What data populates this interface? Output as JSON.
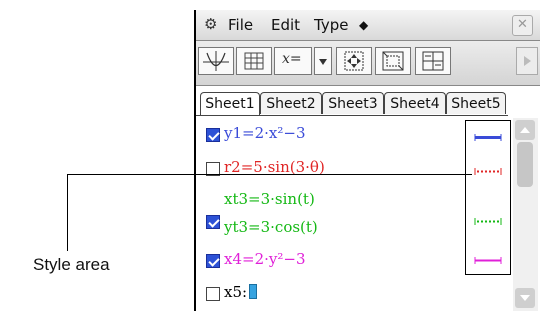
{
  "menu": {
    "items": [
      "File",
      "Edit",
      "Type"
    ]
  },
  "tabs": [
    "Sheet1",
    "Sheet2",
    "Sheet3",
    "Sheet4",
    "Sheet5"
  ],
  "rows": [
    {
      "checked": true,
      "color": "#3a4bd8",
      "line1": "y1=2·x²−3"
    },
    {
      "checked": false,
      "color": "#e02626",
      "line1": "r2=5·sin(3·θ)"
    },
    {
      "checked": true,
      "color": "#14b814",
      "line1": "xt3=3·sin(t)",
      "line2": "yt3=3·cos(t)"
    },
    {
      "checked": true,
      "color": "#e020d8",
      "line1": "x4=2·y²−3"
    },
    {
      "checked": false,
      "color": "#000000",
      "line1": "x5:"
    }
  ],
  "styles": [
    {
      "color": "#3a4bd8",
      "pattern": "solid-thick"
    },
    {
      "color": "#e02626",
      "pattern": "dotted"
    },
    {
      "color": "#14b814",
      "pattern": "dotted"
    },
    {
      "color": "#e020d8",
      "pattern": "solid"
    }
  ],
  "callout": {
    "label": "Style area"
  }
}
